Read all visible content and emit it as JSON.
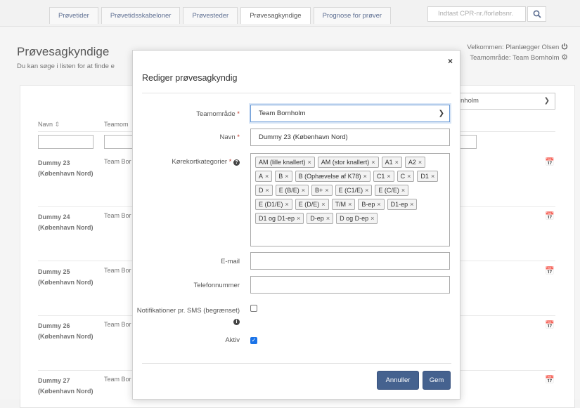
{
  "nav": {
    "tabs": [
      {
        "label": "Prøvetider"
      },
      {
        "label": "Prøvetidsskabeloner"
      },
      {
        "label": "Prøvesteder"
      },
      {
        "label": "Prøvesagkyndige"
      },
      {
        "label": "Prognose for prøver"
      }
    ],
    "active_tab": "Prøvesagkyndige",
    "search_placeholder": "Indtast CPR-nr./forløbsnr.",
    "search_icon": "search-icon"
  },
  "header": {
    "title": "Prøvesagkyndige",
    "subtitle": "Du kan søge i listen for at finde e",
    "welcome": "Velkommen: Planlægger Olsen",
    "team": "Teamområde: Team Bornholm"
  },
  "list": {
    "team_filter_value": "nholm",
    "col_name": "Navn",
    "col_team": "Teamom",
    "rows": [
      {
        "name1": "Dummy 23",
        "name2": "(København Nord)",
        "team": "Team Bor"
      },
      {
        "name1": "Dummy 24",
        "name2": "(København Nord)",
        "team": "Team Bor"
      },
      {
        "name1": "Dummy 25",
        "name2": "(København Nord)",
        "team": "Team Bor"
      },
      {
        "name1": "Dummy 26",
        "name2": "(København Nord)",
        "team": "Team Bor"
      },
      {
        "name1": "Dummy 27",
        "name2": "(København Nord)",
        "team": "Team Bor"
      }
    ]
  },
  "modal": {
    "title": "Rediger prøvesagkyndig",
    "close": "×",
    "teamomraade_label": "Teamområde",
    "teamomraade_value": "Team Bornholm",
    "navn_label": "Navn",
    "navn_value": "Dummy 23 (København Nord)",
    "kategorier_label": "Kørekortkategorier",
    "kategorier": [
      "AM (lille knallert)",
      "AM (stor knallert)",
      "A1",
      "A2",
      "A",
      "B",
      "B (Ophævelse af K78)",
      "C1",
      "C",
      "D1",
      "D",
      "E (B/E)",
      "B+",
      "E (C1/E)",
      "E (C/E)",
      "E (D1/E)",
      "E (D/E)",
      "T/M",
      "B-ep",
      "D1-ep",
      "D1 og D1-ep",
      "D-ep",
      "D og D-ep"
    ],
    "tag_remove": "×",
    "email_label": "E-mail",
    "email_value": "",
    "telefon_label": "Telefonnummer",
    "telefon_value": "",
    "sms_label": "Notifikationer pr. SMS (begrænset)",
    "sms_checked": false,
    "aktiv_label": "Aktiv",
    "aktiv_checked": true,
    "cancel_label": "Annuller",
    "save_label": "Gem"
  },
  "colors": {
    "primary_button": "#45628f",
    "required": "#c0392b",
    "checkbox": "#1a73e8"
  }
}
